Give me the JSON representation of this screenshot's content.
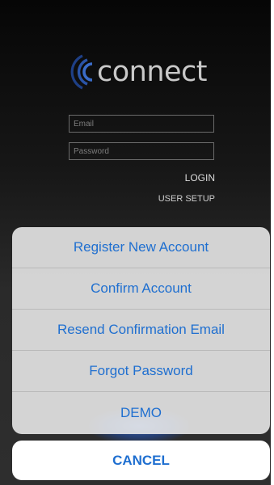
{
  "app": {
    "logo_text": "connect",
    "logo_icon": "signal-waves-icon"
  },
  "login_form": {
    "email_placeholder": "Email",
    "password_placeholder": "Password",
    "login_label": "LOGIN",
    "user_setup_label": "USER SETUP"
  },
  "action_sheet": {
    "items": [
      {
        "label": "Register New Account"
      },
      {
        "label": "Confirm Account"
      },
      {
        "label": "Resend Confirmation Email"
      },
      {
        "label": "Forgot Password"
      },
      {
        "label": "DEMO"
      }
    ],
    "cancel_label": "CANCEL"
  },
  "colors": {
    "background_dark": "#1a1a1a",
    "action_text": "#1f6fd0",
    "logo_blue": "#2f5fb5",
    "logo_text": "#c9c9c9"
  }
}
